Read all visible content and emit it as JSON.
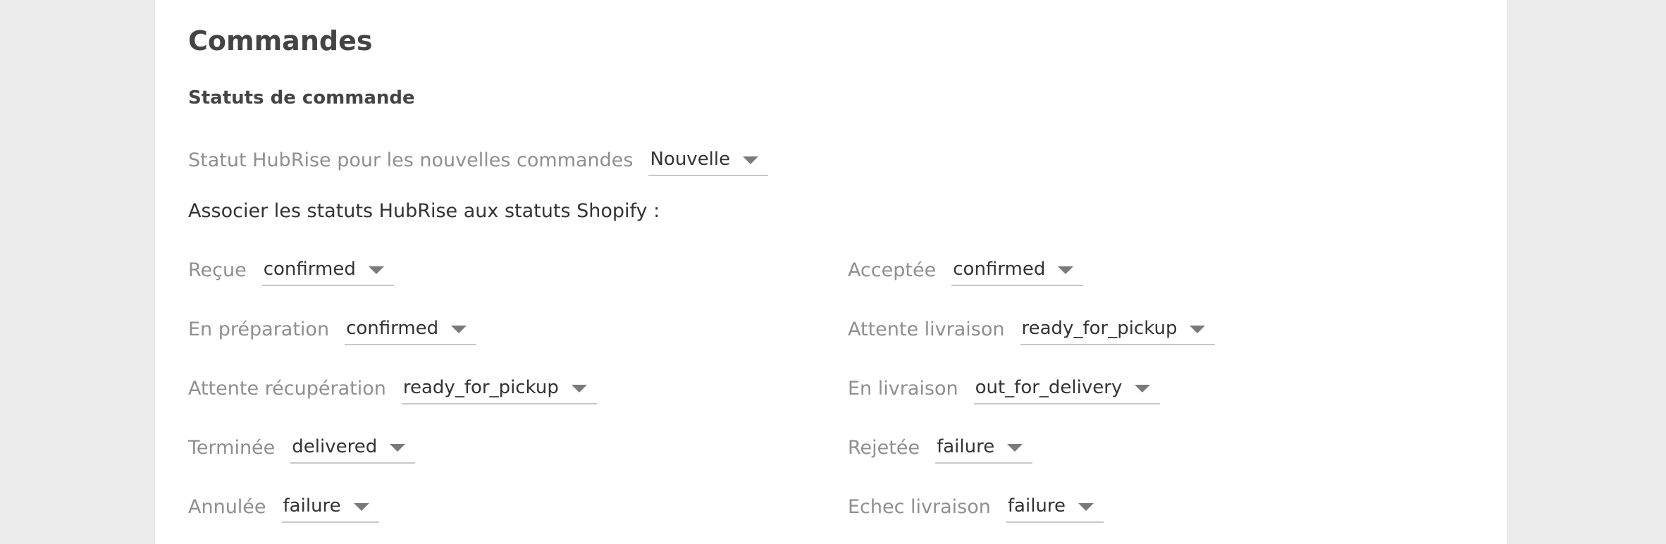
{
  "orders": {
    "title": "Commandes",
    "status_section_title": "Statuts de commande",
    "new_order_status": {
      "label": "Statut HubRise pour les nouvelles commandes",
      "value": "Nouvelle"
    },
    "mapping_intro": "Associer les statuts HubRise aux statuts Shopify :",
    "mappings_left": [
      {
        "label": "Reçue",
        "value": "confirmed"
      },
      {
        "label": "En préparation",
        "value": "confirmed"
      },
      {
        "label": "Attente récupération",
        "value": "ready_for_pickup"
      },
      {
        "label": "Terminée",
        "value": "delivered"
      },
      {
        "label": "Annulée",
        "value": "failure"
      }
    ],
    "mappings_right": [
      {
        "label": "Acceptée",
        "value": "confirmed"
      },
      {
        "label": "Attente livraison",
        "value": "ready_for_pickup"
      },
      {
        "label": "En livraison",
        "value": "out_for_delivery"
      },
      {
        "label": "Rejetée",
        "value": "failure"
      },
      {
        "label": "Echec livraison",
        "value": "failure"
      }
    ]
  }
}
